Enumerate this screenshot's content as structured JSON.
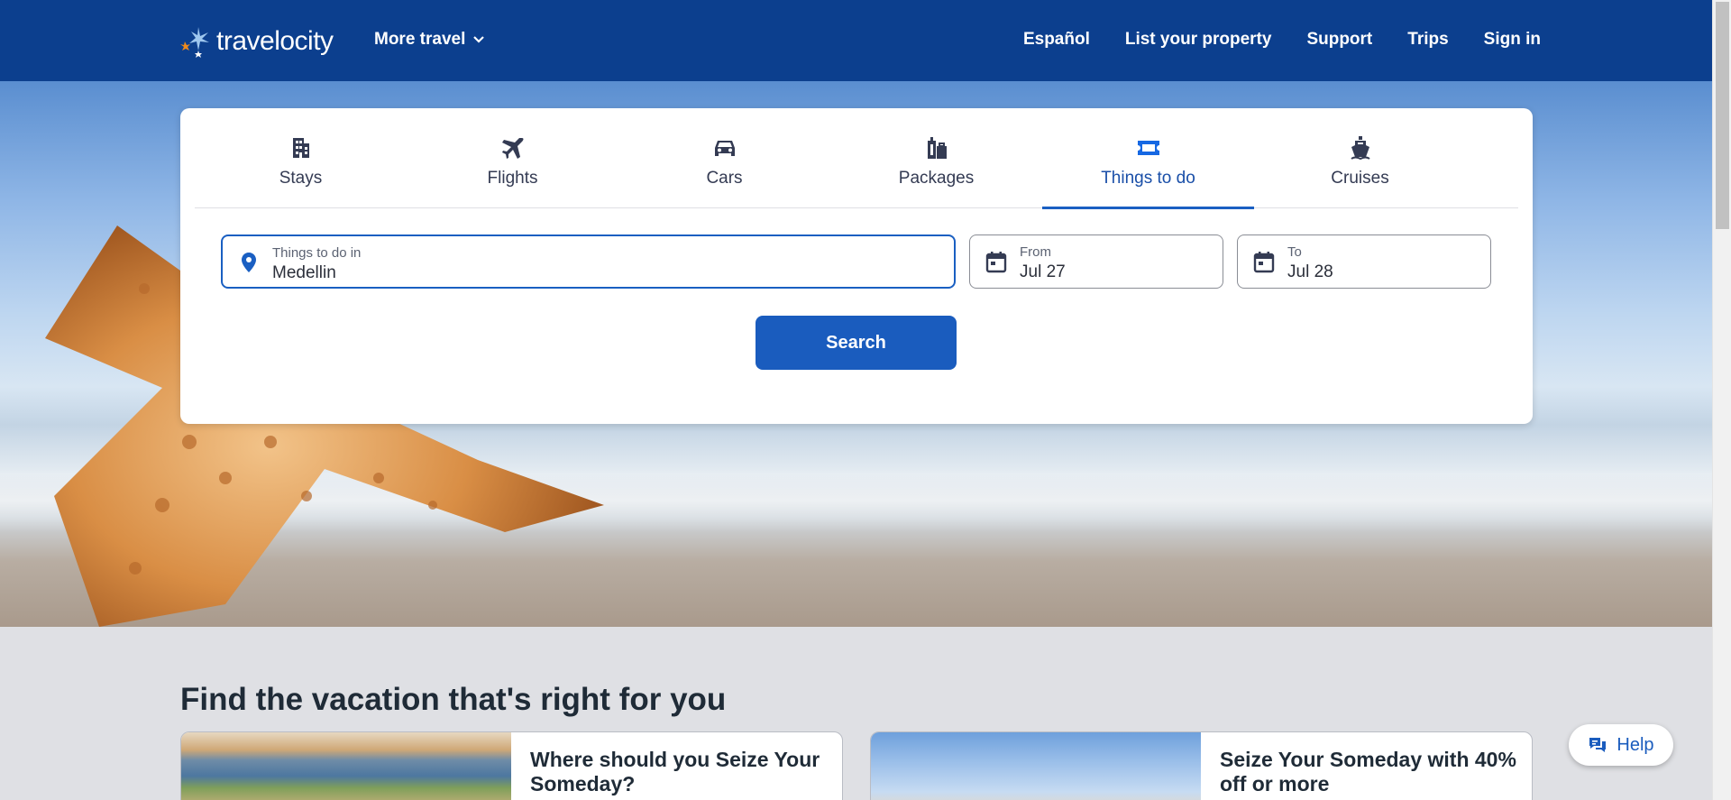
{
  "header": {
    "logo_text": "travelocity",
    "more_travel": "More travel",
    "nav": [
      "Español",
      "List your property",
      "Support",
      "Trips",
      "Sign in"
    ]
  },
  "tabs": [
    {
      "label": "Stays",
      "icon": "building-icon"
    },
    {
      "label": "Flights",
      "icon": "plane-icon"
    },
    {
      "label": "Cars",
      "icon": "car-icon"
    },
    {
      "label": "Packages",
      "icon": "luggage-icon"
    },
    {
      "label": "Things to do",
      "icon": "ticket-icon",
      "active": true
    },
    {
      "label": "Cruises",
      "icon": "ship-icon"
    }
  ],
  "search": {
    "destination": {
      "label": "Things to do in",
      "value": "Medellin"
    },
    "from": {
      "label": "From",
      "value": "Jul 27"
    },
    "to": {
      "label": "To",
      "value": "Jul 28"
    },
    "button": "Search"
  },
  "section": {
    "title": "Find the vacation that's right for you",
    "promos": [
      {
        "text": "Where should you Seize Your Someday?"
      },
      {
        "text": "Seize Your Someday with 40% off or more"
      }
    ]
  },
  "help": {
    "label": "Help"
  },
  "colors": {
    "header": "#0c3f8e",
    "accent": "#1a5cbe",
    "active_tab": "#1668e3"
  }
}
